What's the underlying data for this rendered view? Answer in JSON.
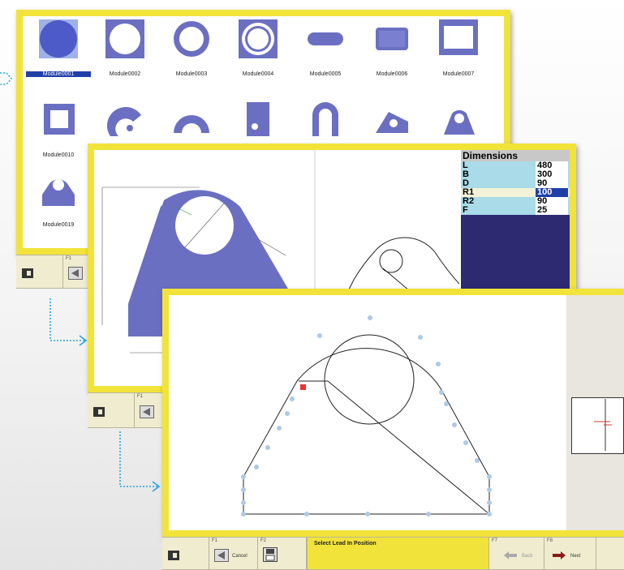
{
  "library": {
    "modules": [
      {
        "label": "Module0001",
        "shape": "filled-circle"
      },
      {
        "label": "Module0002",
        "shape": "circle-in-square"
      },
      {
        "label": "Module0003",
        "shape": "ring"
      },
      {
        "label": "Module0004",
        "shape": "ring-in-square"
      },
      {
        "label": "Module0005",
        "shape": "slot"
      },
      {
        "label": "Module0006",
        "shape": "rounded-rect"
      },
      {
        "label": "Module0007",
        "shape": "rect-frame"
      },
      {
        "label": "Module0010",
        "shape": "square-frame"
      },
      {
        "label": "",
        "shape": "arc-segment"
      },
      {
        "label": "",
        "shape": "half-ring"
      },
      {
        "label": "",
        "shape": "plate-hole"
      },
      {
        "label": "",
        "shape": "u-shape"
      },
      {
        "label": "",
        "shape": "tear-drop"
      },
      {
        "label": "",
        "shape": "lug"
      },
      {
        "label": "Module0019",
        "shape": "lug-plate"
      }
    ],
    "selected": "Module0001"
  },
  "toolbar1": {
    "f1": "F1"
  },
  "dimensions": {
    "title": "Dimensions",
    "rows": [
      {
        "name": "L",
        "value": "480"
      },
      {
        "name": "B",
        "value": "300"
      },
      {
        "name": "D",
        "value": "90"
      },
      {
        "name": "R1",
        "value": "100"
      },
      {
        "name": "R2",
        "value": "90"
      },
      {
        "name": "F",
        "value": "25"
      }
    ],
    "active_row": "R1"
  },
  "toolbar2": {
    "f1": "F1"
  },
  "toolbar3": {
    "f1": "F1",
    "cancel_label": "Cancel",
    "f2": "F2",
    "status": "Select Lead In Position",
    "f7": "F7",
    "back_label": "Back",
    "f8": "F8",
    "next_label": "Next"
  },
  "colors": {
    "frame": "#f2e33a",
    "part_fill": "#6b6fc2",
    "highlight": "#1f3fa8",
    "dim_bg": "#2d2a72",
    "cell_light": "#a9dbe8"
  }
}
